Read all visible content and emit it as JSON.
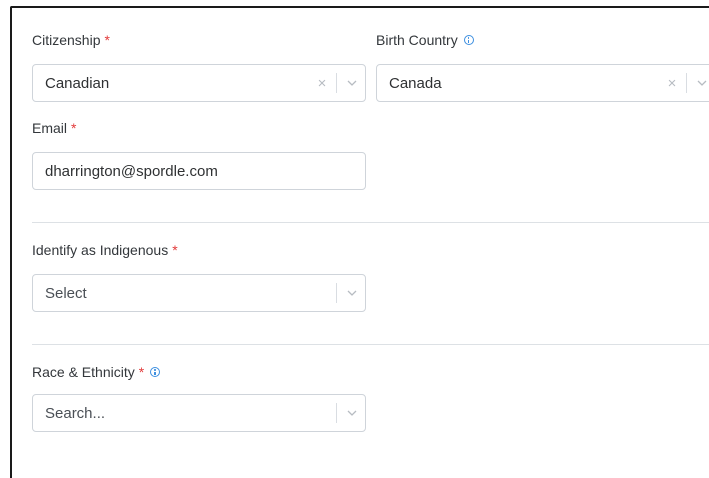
{
  "form": {
    "citizenship": {
      "label": "Citizenship",
      "required_mark": "*",
      "value": "Canadian",
      "clear_symbol": "×"
    },
    "birth_country": {
      "label": "Birth Country",
      "value": "Canada",
      "clear_symbol": "×",
      "info_icon": "info-circle-icon"
    },
    "email": {
      "label": "Email",
      "required_mark": "*",
      "value": "dharrington@spordle.com"
    },
    "indigenous": {
      "label": "Identify as Indigenous",
      "required_mark": "*",
      "placeholder": "Select"
    },
    "race_ethnicity": {
      "label": "Race & Ethnicity",
      "required_mark": "*",
      "placeholder": "Search...",
      "info_icon": "info-circle-icon"
    }
  },
  "colors": {
    "required": "#e23a3a",
    "info": "#3d8fe0",
    "border": "#cfd4da"
  }
}
